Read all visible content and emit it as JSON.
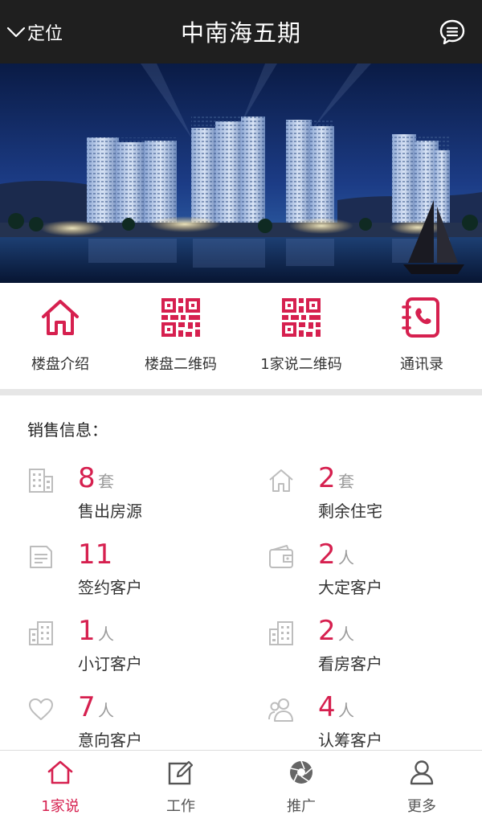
{
  "header": {
    "location_label": "定位",
    "title": "中南海五期"
  },
  "banner": {
    "description": ""
  },
  "quick_menu": [
    {
      "label": "楼盘介绍",
      "icon": "house-icon"
    },
    {
      "label": "楼盘二维码",
      "icon": "qr-code-icon"
    },
    {
      "label": "1家说二维码",
      "icon": "qr-code-icon"
    },
    {
      "label": "通讯录",
      "icon": "contacts-icon"
    }
  ],
  "sales": {
    "title": "销售信息：",
    "stats": [
      {
        "value": "8",
        "unit": "套",
        "label": "售出房源",
        "icon": "building-icon"
      },
      {
        "value": "2",
        "unit": "套",
        "label": "剩余住宅",
        "icon": "house-outline-icon"
      },
      {
        "value": "11",
        "unit": "",
        "label": "签约客户",
        "icon": "document-icon"
      },
      {
        "value": "2",
        "unit": "人",
        "label": "大定客户",
        "icon": "wallet-icon"
      },
      {
        "value": "1",
        "unit": "人",
        "label": "小订客户",
        "icon": "building-icon"
      },
      {
        "value": "2",
        "unit": "人",
        "label": "看房客户",
        "icon": "building-icon"
      },
      {
        "value": "7",
        "unit": "人",
        "label": "意向客户",
        "icon": "heart-icon"
      },
      {
        "value": "4",
        "unit": "人",
        "label": "认筹客户",
        "icon": "group-icon"
      }
    ]
  },
  "tabbar": [
    {
      "label": "1家说",
      "icon": "home-icon",
      "active": true
    },
    {
      "label": "工作",
      "icon": "edit-icon",
      "active": false
    },
    {
      "label": "推广",
      "icon": "aperture-icon",
      "active": false
    },
    {
      "label": "更多",
      "icon": "user-icon",
      "active": false
    }
  ],
  "colors": {
    "accent": "#d6204f",
    "header_bg": "#1f1f1f",
    "muted_icon": "#bdbdbd",
    "divider": "#e6e6e6"
  }
}
